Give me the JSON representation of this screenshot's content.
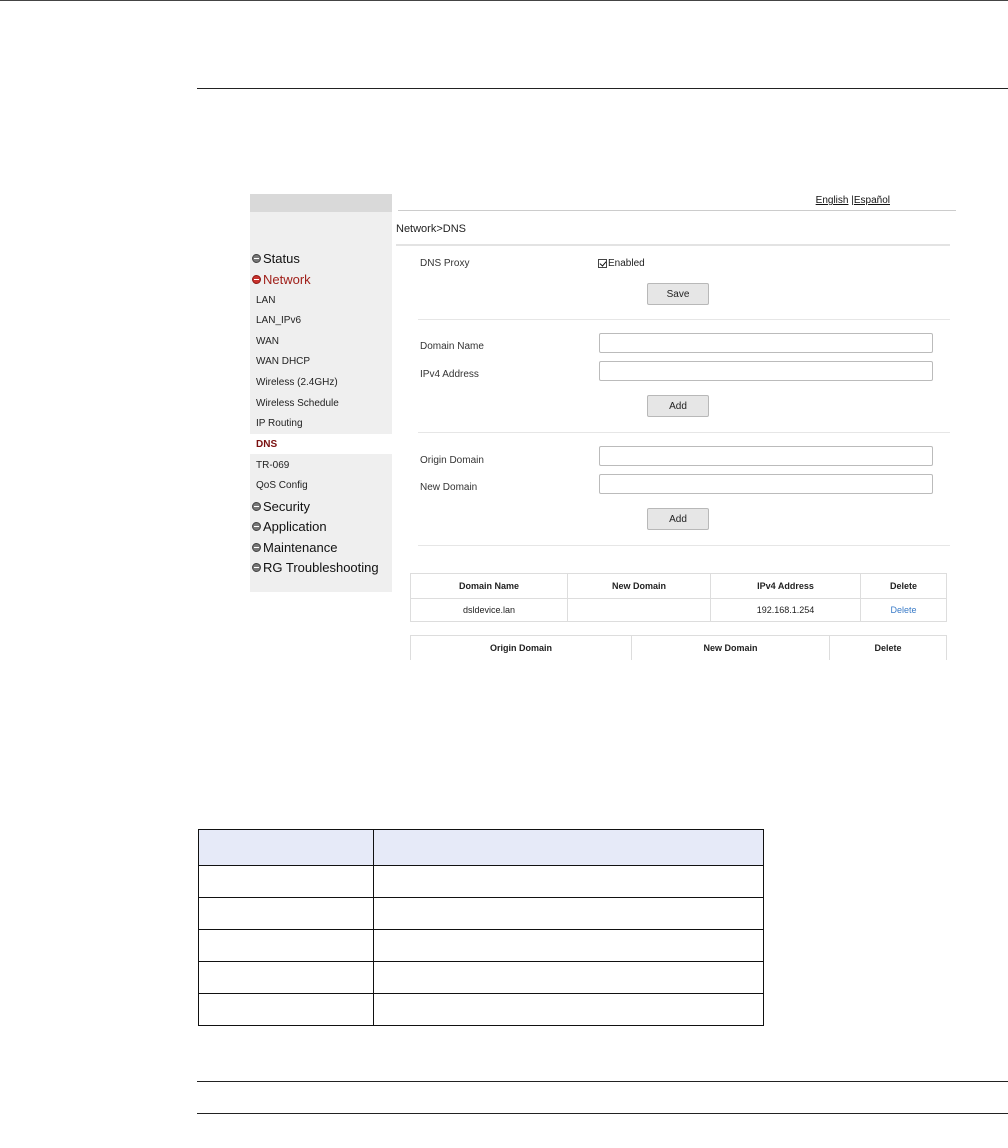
{
  "sidebar": {
    "items": [
      {
        "label": "Status",
        "type": "main"
      },
      {
        "label": "Network",
        "type": "main",
        "active": true
      },
      {
        "label": "LAN",
        "type": "sub"
      },
      {
        "label": "LAN_IPv6",
        "type": "sub"
      },
      {
        "label": "WAN",
        "type": "sub"
      },
      {
        "label": "WAN DHCP",
        "type": "sub"
      },
      {
        "label": "Wireless (2.4GHz)",
        "type": "sub"
      },
      {
        "label": "Wireless Schedule",
        "type": "sub"
      },
      {
        "label": "IP Routing",
        "type": "sub"
      },
      {
        "label": "DNS",
        "type": "sub",
        "selected": true
      },
      {
        "label": "TR-069",
        "type": "sub"
      },
      {
        "label": "QoS Config",
        "type": "sub"
      },
      {
        "label": "Security",
        "type": "main"
      },
      {
        "label": "Application",
        "type": "main"
      },
      {
        "label": "Maintenance",
        "type": "main"
      },
      {
        "label": "RG Troubleshooting",
        "type": "main"
      }
    ]
  },
  "header": {
    "lang_english": "English",
    "lang_separator": " |",
    "lang_spanish": "Español"
  },
  "breadcrumb": "Network>DNS",
  "dns_proxy": {
    "label": "DNS Proxy",
    "checkbox_label": "Enabled",
    "checked": true,
    "save_label": "Save"
  },
  "host_form": {
    "domain_name_label": "Domain Name",
    "ipv4_label": "IPv4 Address",
    "domain_name_value": "",
    "ipv4_value": "",
    "add_label": "Add"
  },
  "alias_form": {
    "origin_label": "Origin Domain",
    "new_label": "New Domain",
    "origin_value": "",
    "new_value": "",
    "add_label": "Add"
  },
  "host_table": {
    "headers": [
      "Domain Name",
      "New Domain",
      "IPv4 Address",
      "Delete"
    ],
    "rows": [
      {
        "domain": "dsldevice.lan",
        "new_domain": "",
        "ipv4": "192.168.1.254",
        "delete": "Delete"
      }
    ]
  },
  "alias_table": {
    "headers": [
      "Origin Domain",
      "New Domain",
      "Delete"
    ]
  },
  "colors": {
    "active_nav": "#a0201a",
    "link": "#3a7bc8",
    "table_header_bg": "#e6eaf8"
  }
}
